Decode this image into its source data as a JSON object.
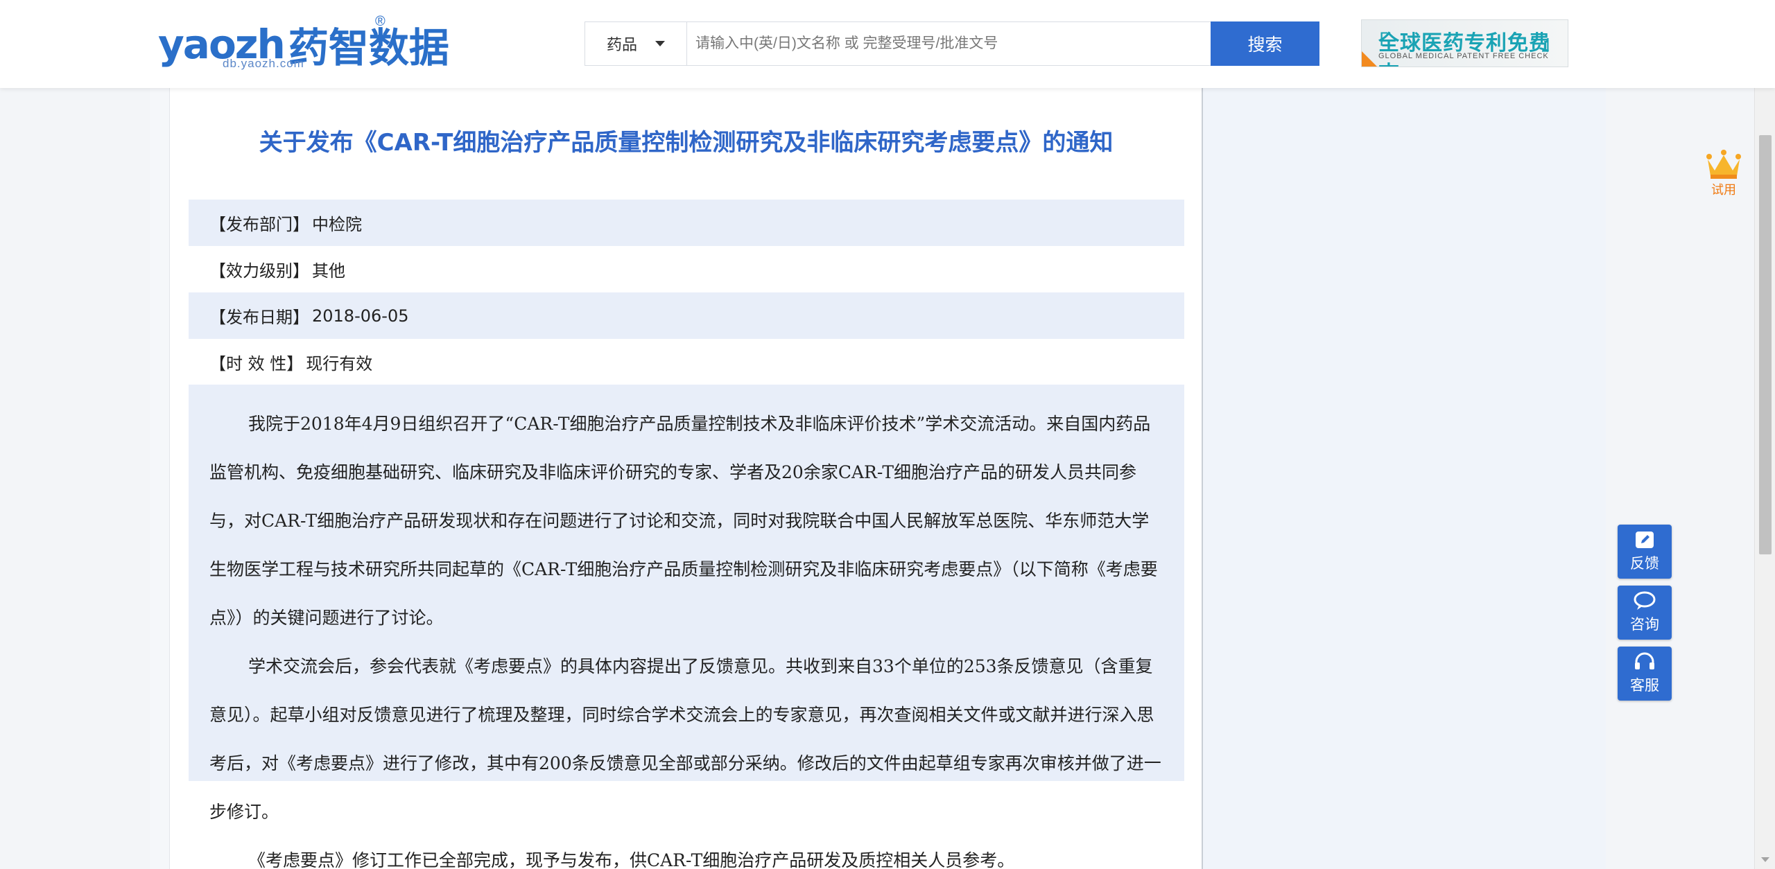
{
  "header": {
    "logo": {
      "latin": "yaozh",
      "cn": "药智数据",
      "sub": "db.yaozh.com",
      "reg": "®"
    },
    "search": {
      "category": "药品",
      "placeholder": "请输入中(英/日)文名称 或 完整受理号/批准文号",
      "button_label": "搜索"
    },
    "banner": {
      "main": "全球医药专利免费查",
      "sub": "GLOBAL MEDICAL PATENT FREE CHECK"
    }
  },
  "article": {
    "title": "关于发布《CAR-T细胞治疗产品质量控制检测研究及非临床研究考虑要点》的通知",
    "meta": [
      {
        "label": "【发布部门】",
        "value": "中检院"
      },
      {
        "label": "【效力级别】",
        "value": "其他"
      },
      {
        "label": "【发布日期】",
        "value": "2018-06-05"
      },
      {
        "label": "【时 效 性】",
        "value": "现行有效"
      }
    ],
    "paragraphs": [
      "我院于2018年4月9日组织召开了“CAR-T细胞治疗产品质量控制技术及非临床评价技术”学术交流活动。来自国内药品监管机构、免疫细胞基础研究、临床研究及非临床评价研究的专家、学者及20余家CAR-T细胞治疗产品的研发人员共同参与，对CAR-T细胞治疗产品研发现状和存在问题进行了讨论和交流，同时对我院联合中国人民解放军总医院、华东师范大学生物医学工程与技术研究所共同起草的《CAR-T细胞治疗产品质量控制检测研究及非临床研究考虑要点》（以下简称《考虑要点》）的关键问题进行了讨论。",
      "学术交流会后，参会代表就《考虑要点》的具体内容提出了反馈意见。共收到来自33个单位的253条反馈意见（含重复意见）。起草小组对反馈意见进行了梳理及整理，同时综合学术交流会上的专家意见，再次查阅相关文件或文献并进行深入思考后，对《考虑要点》进行了修改，其中有200条反馈意见全部或部分采纳。修改后的文件由起草组专家再次审核并做了进一步修订。",
      "《考虑要点》修订工作已全部完成，现予与发布，供CAR-T细胞治疗产品研发及质控相关人员参考。"
    ]
  },
  "sidebar_widgets": {
    "trial_label": "试用",
    "buttons": [
      {
        "label": "反馈",
        "icon": "edit-icon"
      },
      {
        "label": "咨询",
        "icon": "chat-bubble-icon"
      },
      {
        "label": "客服",
        "icon": "headset-icon"
      }
    ]
  },
  "colors": {
    "brand": "#2f6cd0",
    "title": "#2f66c8",
    "shade": "#e8eef9",
    "accent": "#f07a12"
  }
}
